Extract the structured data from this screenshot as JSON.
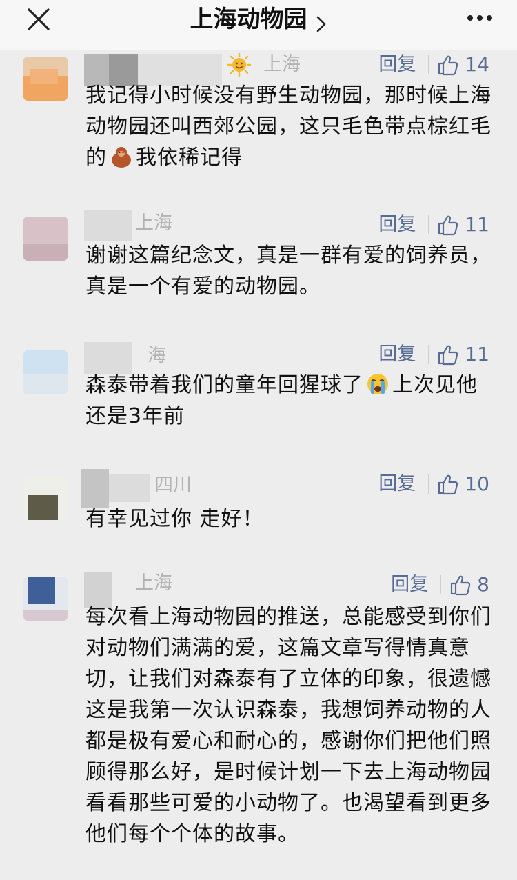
{
  "header": {
    "title": "上海动物园"
  },
  "comments": [
    {
      "location": "上海",
      "reply_label": "回复",
      "likes": "14",
      "text_before_emoji": "我记得小时候没有野生动物园，那时候上海动物园还叫西郊公园，这只毛色带点棕红毛的",
      "text_after_emoji": "我依稀记得",
      "emoji": "orangutan-emoji"
    },
    {
      "location": "上海",
      "reply_label": "回复",
      "likes": "11",
      "text": "谢谢这篇纪念文，真是一群有爱的饲养员，真是一个有爱的动物园。"
    },
    {
      "location": "海",
      "reply_label": "回复",
      "likes": "11",
      "text_before_emoji": "森泰带着我们的童年回猩球了",
      "text_after_emoji": "上次见他还是3年前",
      "emoji": "crying-face-emoji"
    },
    {
      "location": "四川",
      "reply_label": "回复",
      "likes": "10",
      "text": "有幸见过你 走好！"
    },
    {
      "location": "上海",
      "reply_label": "回复",
      "likes": "8",
      "text": "每次看上海动物园的推送，总能感受到你们对动物们满满的爱，这篇文章写得情真意切，让我们对森泰有了立体的印象，很遗憾这是我第一次认识森泰，我想饲养动物的人都是极有爱心和耐心的，感谢你们把他们照顾得那么好，是时候计划一下去上海动物园看看那些可爱的小动物了。也渴望看到更多他们每个个体的故事。"
    }
  ],
  "colors": {
    "background": "#ededed",
    "link": "#576b95",
    "location": "#b3b3b3"
  }
}
